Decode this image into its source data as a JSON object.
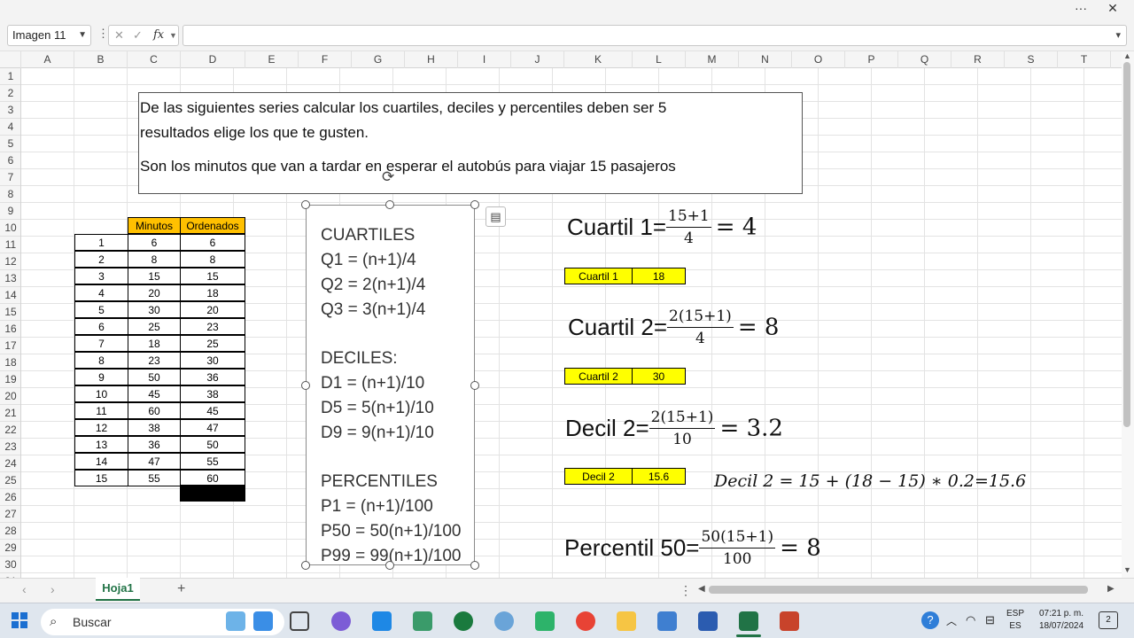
{
  "window": {
    "more_label": "···",
    "close_label": "✕"
  },
  "formula_bar": {
    "name_box": "Imagen 11",
    "cancel_glyph": "✕",
    "enter_glyph": "✓",
    "fx_label": "fx",
    "formula_value": ""
  },
  "columns": [
    "A",
    "B",
    "C",
    "D",
    "E",
    "F",
    "G",
    "H",
    "I",
    "J",
    "K",
    "L",
    "M",
    "N",
    "O",
    "P",
    "Q",
    "R",
    "S",
    "T"
  ],
  "rows": [
    "1",
    "2",
    "3",
    "4",
    "5",
    "6",
    "7",
    "8",
    "9",
    "10",
    "11",
    "12",
    "13",
    "14",
    "15",
    "16",
    "17",
    "18",
    "19",
    "20",
    "21",
    "22",
    "23",
    "24",
    "25",
    "26",
    "27",
    "28",
    "29",
    "30",
    "31"
  ],
  "table": {
    "headers": [
      "Minutos",
      "Ordenados"
    ],
    "index": [
      "1",
      "2",
      "3",
      "4",
      "5",
      "6",
      "7",
      "8",
      "9",
      "10",
      "11",
      "12",
      "13",
      "14",
      "15"
    ],
    "minutos": [
      "6",
      "8",
      "15",
      "20",
      "30",
      "25",
      "18",
      "23",
      "50",
      "45",
      "60",
      "38",
      "36",
      "47",
      "55"
    ],
    "ordenados": [
      "6",
      "8",
      "15",
      "18",
      "20",
      "23",
      "25",
      "30",
      "36",
      "38",
      "45",
      "47",
      "50",
      "55",
      "60"
    ]
  },
  "textbox": {
    "line1": "De las siguientes series calcular los cuartiles, deciles y percentiles deben ser 5",
    "line2": "resultados elige los que te gusten.",
    "line3": "Son los minutos que van a tardar en esperar el autobús para viajar 15 pasajeros"
  },
  "image_formulas": {
    "cuartiles_title": "CUARTILES",
    "q1": "Q1 = (n+1)/4",
    "q2": "Q2 = 2(n+1)/4",
    "q3": "Q3 = 3(n+1)/4",
    "deciles_title": "DECILES:",
    "d1": "D1 = (n+1)/10",
    "d5": "D5 = 5(n+1)/10",
    "d9": "D9 = 9(n+1)/10",
    "percentiles_title": "PERCENTILES",
    "p1": "P1 = (n+1)/100",
    "p50": "P50 = 50(n+1)/100",
    "p99": "P99 = 99(n+1)/100"
  },
  "equations": {
    "c1_label": "Cuartil 1=",
    "c1_num": "15+1",
    "c1_den": "4",
    "c1_res": "= 4",
    "c2_label": "Cuartil 2=",
    "c2_num": "2(15+1)",
    "c2_den": "4",
    "c2_res": "= 8",
    "d2_label": "Decil 2=",
    "d2_num": "2(15+1)",
    "d2_den": "10",
    "d2_res": "= 3.2",
    "p50_label": "Percentil 50=",
    "p50_num": "50(15+1)",
    "p50_den": "100",
    "p50_res": "= 8",
    "decil_interp": "Decil 2 = 15 + (18 − 15) ∗ 0.2=15.6"
  },
  "results": [
    {
      "label": "Cuartil 1",
      "value": "18"
    },
    {
      "label": "Cuartil 2",
      "value": "30"
    },
    {
      "label": "Decil 2",
      "value": "15.6"
    }
  ],
  "sheet_tabs": {
    "active": "Hoja1",
    "add_label": "+"
  },
  "taskbar": {
    "search_placeholder": "Buscar",
    "lang_top": "ESP",
    "lang_bottom": "ES",
    "time": "07:21 p. m.",
    "date": "18/07/2024",
    "notification_count": "2"
  },
  "colors": {
    "header_orange": "#ffc000",
    "result_yellow": "#ffff00",
    "excel_green": "#217346"
  }
}
